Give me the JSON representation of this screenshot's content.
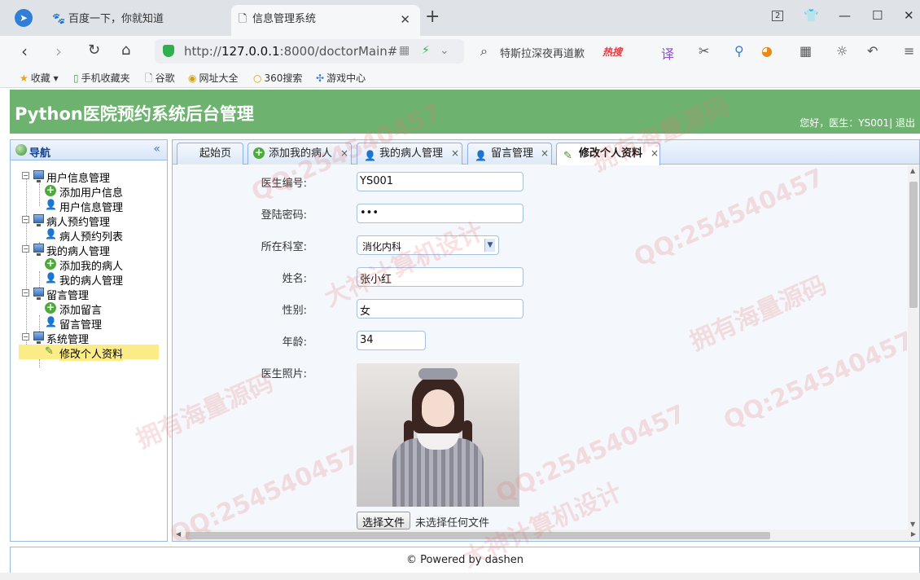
{
  "browser": {
    "tabs": [
      {
        "label": "百度一下，你就知道",
        "favicon": "baidu-paw-icon"
      },
      {
        "label": "信息管理系统",
        "favicon": "page-icon",
        "close": "✕"
      }
    ],
    "window_controls": {
      "badge": "2"
    },
    "address": {
      "host": "127.0.0.1",
      "prefix": "http://",
      "rest": ":8000/doctorMain#"
    },
    "search": {
      "text": "特斯拉深夜再道歉",
      "hot": "热搜"
    },
    "bookmarks": [
      "收藏",
      "手机收藏夹",
      "谷歌",
      "网址大全",
      "360搜索",
      "游戏中心"
    ]
  },
  "app": {
    "title": "Python医院预约系统后台管理",
    "user_text": "您好，医生：YS001| 退出"
  },
  "sidebar": {
    "title": "导航",
    "groups": [
      {
        "label": "用户信息管理",
        "items": [
          {
            "label": "添加用户信息",
            "icon": "add-icon"
          },
          {
            "label": "用户信息管理",
            "icon": "user-icon"
          }
        ]
      },
      {
        "label": "病人预约管理",
        "items": [
          {
            "label": "病人预约列表",
            "icon": "user-icon"
          }
        ]
      },
      {
        "label": "我的病人管理",
        "items": [
          {
            "label": "添加我的病人",
            "icon": "add-icon"
          },
          {
            "label": "我的病人管理",
            "icon": "user-icon"
          }
        ]
      },
      {
        "label": "留言管理",
        "items": [
          {
            "label": "添加留言",
            "icon": "add-icon"
          },
          {
            "label": "留言管理",
            "icon": "user-icon"
          }
        ]
      },
      {
        "label": "系统管理",
        "items": [
          {
            "label": "修改个人资料",
            "icon": "edit-icon",
            "selected": true
          }
        ]
      }
    ]
  },
  "tabs": [
    {
      "label": "起始页"
    },
    {
      "label": "添加我的病人",
      "close": "×"
    },
    {
      "label": "我的病人管理",
      "close": "×"
    },
    {
      "label": "留言管理",
      "close": "×"
    },
    {
      "label": "修改个人资料",
      "close": "×",
      "active": true
    }
  ],
  "form": {
    "doctor_no": {
      "label": "医生编号:",
      "value": "YS001"
    },
    "password": {
      "label": "登陆密码:",
      "value": "•••"
    },
    "department": {
      "label": "所在科室:",
      "value": "消化内科"
    },
    "name": {
      "label": "姓名:",
      "value": "张小红"
    },
    "gender": {
      "label": "性别:",
      "value": "女"
    },
    "age": {
      "label": "年龄:",
      "value": "34"
    },
    "photo": {
      "label": "医生照片:"
    },
    "file_button": "选择文件",
    "file_status": "未选择任何文件"
  },
  "footer": {
    "text": "© Powered by dashen"
  },
  "watermarks": [
    "QQ:254540457",
    "拥有海量源码",
    "大神计算机设计"
  ]
}
